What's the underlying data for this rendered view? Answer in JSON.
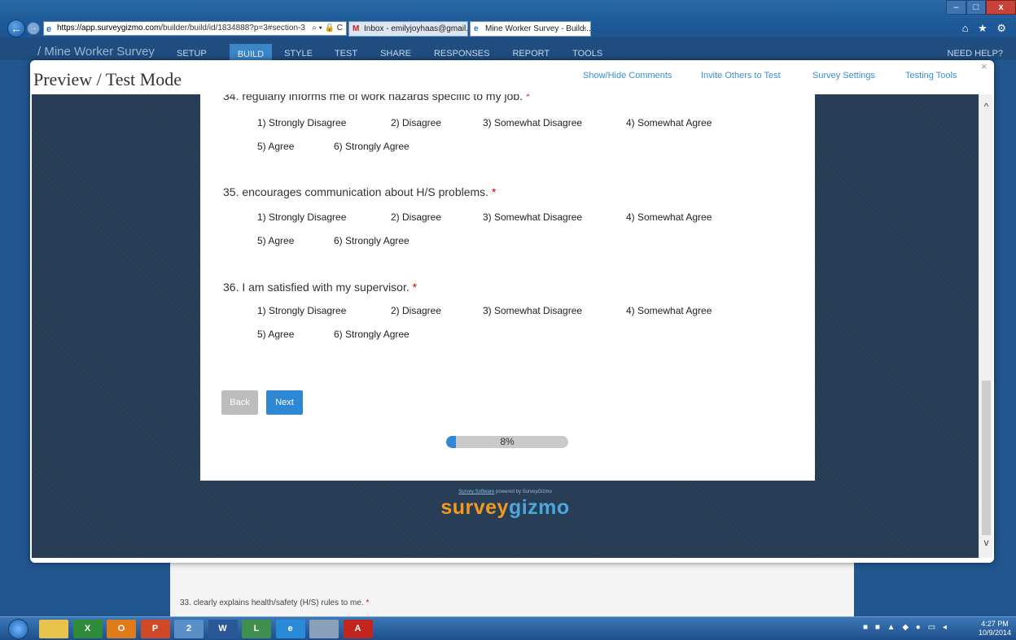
{
  "browser": {
    "url_host": "https://app.surveygizmo.com",
    "url_path": "/builder/build/id/1834888?p=3#section-3",
    "url_tools": "⌕ ▾ 🔒 C",
    "tabs": [
      {
        "icon": "M",
        "label": "Inbox - emilyjoyhaas@gmail.c..."
      },
      {
        "icon": "e",
        "label": "Mine Worker Survey - Build...",
        "close": "×"
      }
    ],
    "window_controls": {
      "minimize": "–",
      "maximize": "□",
      "close": "x"
    },
    "toolbar_icons": "⌂ ★ ⚙"
  },
  "app_nav": {
    "survey_name": "/ Mine Worker Survey",
    "items": [
      "SETUP",
      "BUILD",
      "STYLE",
      "TEST",
      "SHARE",
      "RESPONSES",
      "REPORT",
      "TOOLS"
    ],
    "active": "BUILD",
    "help": "NEED HELP?"
  },
  "modal": {
    "title": "Preview / Test Mode",
    "links": [
      "Show/Hide Comments",
      "Invite Others to Test",
      "Survey Settings",
      "Testing Tools"
    ],
    "close": "×"
  },
  "survey": {
    "questions": [
      {
        "text": "34. regularly informs me of work hazards specific to my job.",
        "required_mark": "*",
        "options": [
          "1) Strongly Disagree",
          "2) Disagree",
          "3) Somewhat Disagree",
          "4) Somewhat Agree",
          "5) Agree",
          "6) Strongly Agree"
        ]
      },
      {
        "text": "35. encourages communication about H/S problems.",
        "required_mark": "*",
        "options": [
          "1) Strongly Disagree",
          "2) Disagree",
          "3) Somewhat Disagree",
          "4) Somewhat Agree",
          "5) Agree",
          "6) Strongly Agree"
        ]
      },
      {
        "text": "36. I am satisfied with my supervisor.",
        "required_mark": "*",
        "options": [
          "1) Strongly Disagree",
          "2) Disagree",
          "3) Somewhat Disagree",
          "4) Somewhat Agree",
          "5) Agree",
          "6) Strongly Agree"
        ]
      }
    ],
    "back_label": "Back",
    "next_label": "Next",
    "progress_percent": 8,
    "progress_label": "8%"
  },
  "footer": {
    "powered_link": "Survey Software",
    "powered_text": "powered by SurveyGizmo",
    "logo_part1": "survey",
    "logo_part2": "gizmo"
  },
  "background": {
    "question_33": "33. clearly explains health/safety (H/S) rules to me.",
    "required_mark": "*"
  },
  "scrollbar": {
    "up": "^",
    "down": "v"
  },
  "taskbar": {
    "icons": [
      {
        "name": "file-explorer",
        "label": "",
        "color": "#e8c24a"
      },
      {
        "name": "excel",
        "label": "X",
        "color": "#2e8b3a"
      },
      {
        "name": "outlook",
        "label": "O",
        "color": "#e07b1a"
      },
      {
        "name": "powerpoint",
        "label": "P",
        "color": "#d24726"
      },
      {
        "name": "lync",
        "label": "2",
        "color": "#5a8fc8"
      },
      {
        "name": "word",
        "label": "W",
        "color": "#2b5797"
      },
      {
        "name": "project",
        "label": "L",
        "color": "#3f8f4f"
      },
      {
        "name": "internet-explorer",
        "label": "e",
        "color": "#2a8ad8"
      },
      {
        "name": "calculator",
        "label": "",
        "color": "#8aa0b8"
      },
      {
        "name": "acrobat",
        "label": "A",
        "color": "#c0261e"
      }
    ],
    "tray": "■ ■ ▲ ◆ ● ▭ ◂",
    "time": "4:27 PM",
    "date": "10/9/2014"
  }
}
